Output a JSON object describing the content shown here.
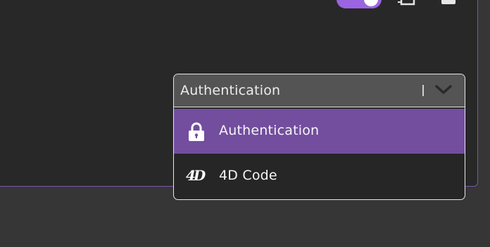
{
  "dropdown": {
    "selected_value": "Authentication",
    "options": [
      {
        "label": "Authentication",
        "icon": "lock-icon",
        "highlighted": true
      },
      {
        "label": "4D Code",
        "icon": "4d-logo-icon",
        "highlighted": false
      }
    ],
    "logo_text": "4D"
  },
  "colors": {
    "accent": "#9b64e0",
    "highlight": "#734d9e",
    "panel": "#282828",
    "background": "#363636"
  }
}
